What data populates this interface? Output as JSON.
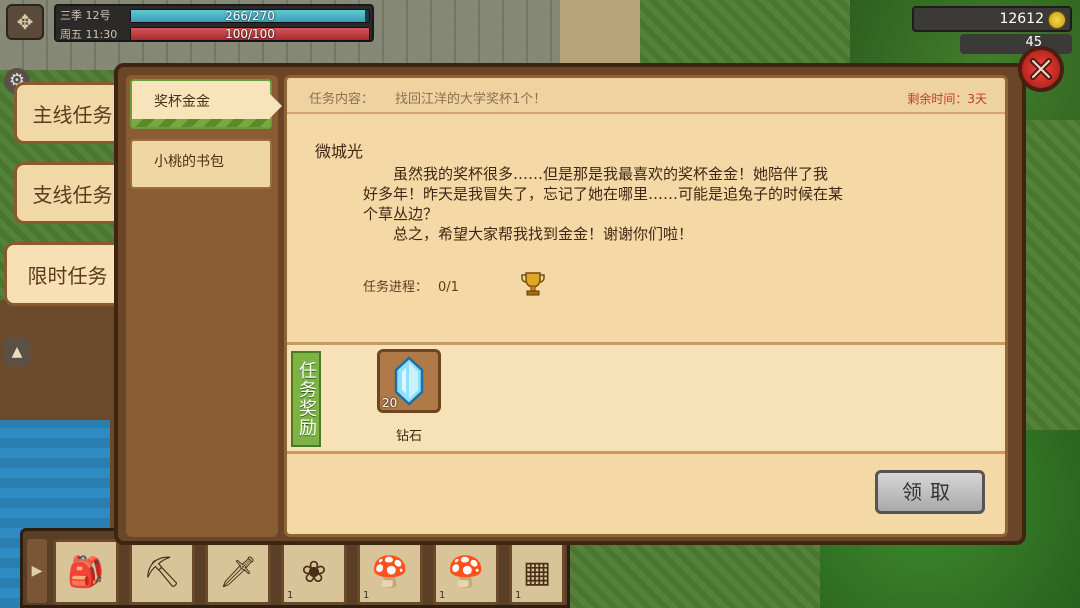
{
  "hud": {
    "season": "三季 12号",
    "time": "周五 11:30",
    "health": {
      "value": "266/270",
      "fraction": 0.985
    },
    "energy": {
      "value": "100/100",
      "fraction": 1.0
    },
    "gold": "12612",
    "gems": "45"
  },
  "tabs": {
    "main": "主线任务",
    "side": "支线任务",
    "limited": "限时任务"
  },
  "quest_list": [
    {
      "title": "奖杯金金"
    },
    {
      "title": "小桃的书包"
    }
  ],
  "quest": {
    "content_label": "任务内容：",
    "content_text": "找回江洋的大学奖杯1个！",
    "time_left": "剩余时间：3天",
    "giver": "微城光",
    "story_1": "虽然我的奖杯很多……但是那是我最喜欢的奖杯金金！她陪伴了我",
    "story_2": "好多年！昨天是我冒失了，忘记了她在哪里……可能是追兔子的时候在某",
    "story_3": "个草丛边？",
    "story_4": "总之，希望大家帮我找到金金！谢谢你们啦！",
    "progress_label": "任务进程：",
    "progress_value": "0/1",
    "progress_icon": "trophy-icon"
  },
  "reward": {
    "label": "任务奖励",
    "item_name": "钻石",
    "item_count": "20",
    "item_icon": "diamond-icon"
  },
  "claim_label": "领取",
  "toolbar": {
    "slots": [
      {
        "icon": "backpack-icon",
        "count": ""
      },
      {
        "icon": "hoe-icon",
        "count": ""
      },
      {
        "icon": "sword-icon",
        "count": ""
      },
      {
        "icon": "lavender-icon",
        "count": "1"
      },
      {
        "icon": "mushroom-icon",
        "count": "1"
      },
      {
        "icon": "mushroom-icon",
        "count": "1"
      },
      {
        "icon": "chest-icon",
        "count": "1"
      }
    ]
  },
  "colors": {
    "accent_green": "#7bb444",
    "time_red": "#c23b23",
    "panel_bg": "#f4d9a6",
    "frame_brown": "#6b4528"
  }
}
